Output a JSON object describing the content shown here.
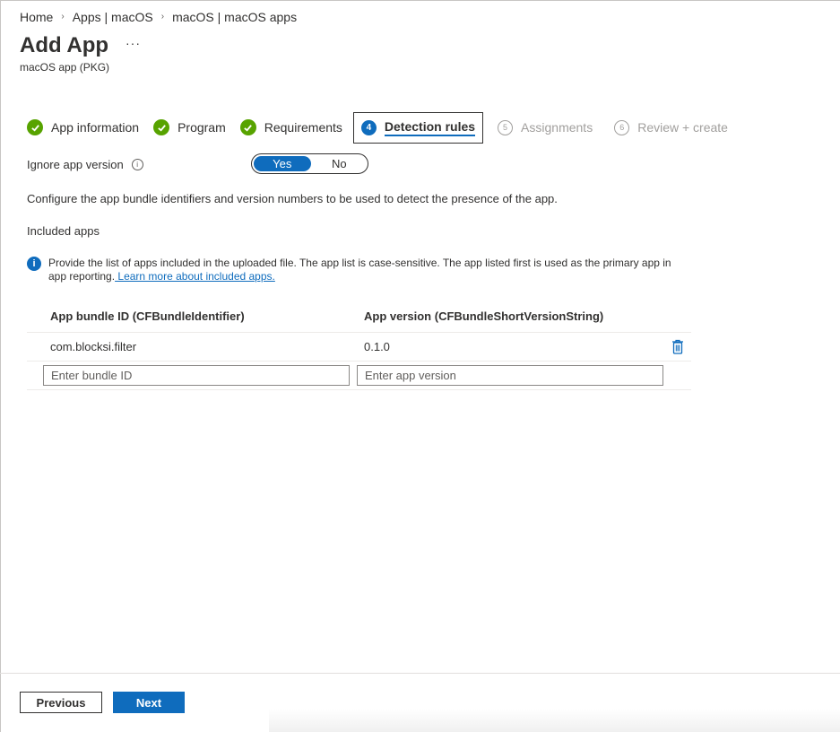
{
  "breadcrumb": [
    "Home",
    "Apps | macOS",
    "macOS | macOS apps"
  ],
  "page": {
    "title": "Add App",
    "more": "···",
    "subtitle": "macOS app (PKG)"
  },
  "steps": [
    {
      "label": "App information",
      "state": "done"
    },
    {
      "label": "Program",
      "state": "done"
    },
    {
      "label": "Requirements",
      "state": "done"
    },
    {
      "num": "4",
      "label": "Detection rules",
      "state": "active"
    },
    {
      "num": "5",
      "label": "Assignments",
      "state": "pending"
    },
    {
      "num": "6",
      "label": "Review + create",
      "state": "pending"
    }
  ],
  "ignore_version": {
    "label": "Ignore app version",
    "info": "i",
    "options": [
      "Yes",
      "No"
    ],
    "selected": "Yes"
  },
  "description": "Configure the app bundle identifiers and version numbers to be used to detect the presence of the app.",
  "included_label": "Included apps",
  "info_bar": {
    "icon": "i",
    "text": "Provide the list of apps included in the uploaded file. The app list is case-sensitive. The app listed first is used as the primary app in app reporting.",
    "link": " Learn more about included apps."
  },
  "table": {
    "headers": [
      "App bundle ID (CFBundleIdentifier)",
      "App version (CFBundleShortVersionString)"
    ],
    "rows": [
      {
        "bundle_id": "com.blocksi.filter",
        "version": "0.1.0"
      }
    ],
    "bundle_placeholder": "Enter bundle ID",
    "version_placeholder": "Enter app version"
  },
  "footer": {
    "previous": "Previous",
    "next": "Next"
  },
  "colors": {
    "accent": "#0f6cbd",
    "success": "#57a300"
  }
}
